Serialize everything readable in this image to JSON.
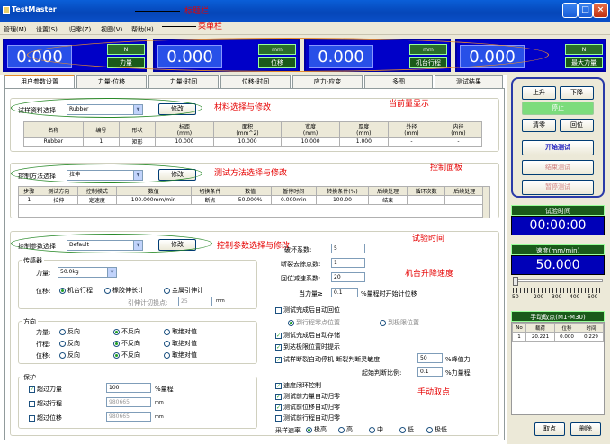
{
  "window": {
    "title": "TestMaster",
    "minimize": "_",
    "maximize": "□",
    "close": "×"
  },
  "menu": [
    "管理(M)",
    "设置(S)",
    "归零(Z)",
    "视图(V)",
    "帮助(H)"
  ],
  "readouts": [
    {
      "value": "0.000",
      "unit": "N",
      "label": "力量"
    },
    {
      "value": "0.000",
      "unit": "mm",
      "label": "位移"
    },
    {
      "value": "0.000",
      "unit": "mm",
      "label": "机台行程"
    },
    {
      "value": "0.000",
      "unit": "N",
      "label": "最大力量"
    }
  ],
  "tabs": [
    "用户参数设置",
    "力量-位移",
    "力量-时间",
    "位移-时间",
    "应力-应变",
    "多图",
    "测试结果"
  ],
  "material": {
    "label": "试样资料选择",
    "selected": "Rubber",
    "edit": "修改",
    "headers": [
      "名称",
      "编号",
      "形状",
      "标距",
      "面积",
      "宽度",
      "厚度",
      "外径",
      "内径"
    ],
    "units": [
      "",
      "",
      "",
      "(mm)",
      "(mm^2)",
      "(mm)",
      "(mm)",
      "(mm)",
      "(mm)"
    ],
    "row": [
      "Rubber",
      "1",
      "矩形",
      "10.000",
      "10.000",
      "10.000",
      "1.000",
      "-",
      "-"
    ]
  },
  "method": {
    "label": "控制方法选择",
    "selected": "拉伸",
    "edit": "修改",
    "headers": [
      "步骤",
      "测试方向",
      "控制模式",
      "数值",
      "切换条件",
      "数值",
      "暂停时间",
      "转换条件(%)",
      "后续处理",
      "循环次数",
      "后续处理"
    ],
    "row": [
      "1",
      "拉伸",
      "定速度",
      "100.000mm/min",
      "断点",
      "50.000%",
      "0.000min",
      "100.00",
      "结束",
      "",
      ""
    ]
  },
  "params": {
    "label": "控制参数选择",
    "selected": "Default",
    "edit": "修改",
    "sensor": "传感器",
    "force_label": "力量:",
    "force_value": "50.0kg",
    "disp_label": "位移:",
    "disp_opts": [
      "机台行程",
      "橡胶伸长计",
      "金属引伸计"
    ],
    "switch_label": "引伸计切换点:",
    "switch_value": "25",
    "switch_unit": "mm",
    "direction": "方向",
    "dir_rows": [
      {
        "label": "力量:",
        "opts": [
          "反向",
          "不反向",
          "取绝对值"
        ]
      },
      {
        "label": "行程:",
        "opts": [
          "反向",
          "不反向",
          "取绝对值"
        ]
      },
      {
        "label": "位移:",
        "opts": [
          "反向",
          "不反向",
          "取绝对值"
        ]
      }
    ],
    "protect": "保护",
    "prot_rows": [
      {
        "label": "超过力量",
        "value": "100",
        "unit": "%量程"
      },
      {
        "label": "超过行程",
        "value": "980665",
        "unit": "mm"
      },
      {
        "label": "超过位移",
        "value": "980665",
        "unit": "mm"
      }
    ],
    "break_coef_label": "破坏系数:",
    "break_coef": "5",
    "remove_label": "断裂去除点数:",
    "remove": "1",
    "return_label": "回位减速系数:",
    "return": "20",
    "force_ge_label": "当力量≥",
    "force_ge": "0.1",
    "force_ge_unit": "%量程时开始计位移",
    "chk1": "测试完成后自动回位",
    "sub1": "到行程零点位置",
    "sub2": "到极限位置",
    "chk2": "测试完成后自动存储",
    "chk3": "到达极限位置时提示",
    "chk4": "试样断裂自动停机 断裂判断灵敏度:",
    "sens": "50",
    "sens_unit": "%峰值力",
    "start_label": "起始判断比例:",
    "start": "0.1",
    "start_unit": "%力量程",
    "chk5": "速度闭环控制",
    "chk6": "测试前力量自动归零",
    "chk7": "测试前位移自动归零",
    "chk8": "测试前行程自动归零",
    "rate_label": "采样速率",
    "rate_opts": [
      "极高",
      "高",
      "中",
      "低",
      "极低"
    ]
  },
  "control": {
    "up": "上升",
    "down": "下降",
    "stop": "停止",
    "clear": "清零",
    "return": "回位",
    "start": "开始测试",
    "end": "结束测试",
    "pause": "暂停测试"
  },
  "time": {
    "label": "试验时间",
    "value": "00:00:00"
  },
  "speed": {
    "label": "速度(mm/min)",
    "value": "50.000",
    "scale": [
      "50",
      "200",
      "300",
      "400",
      "500"
    ]
  },
  "manual": {
    "label": "手动取点(M1-M30)",
    "headers": [
      "No",
      "载荷",
      "位移",
      "时间"
    ],
    "row": [
      "1",
      "20.221",
      "0.000",
      "0.229"
    ],
    "pick": "取点",
    "delete": "删除"
  },
  "annotations": {
    "title": "标题栏",
    "menu": "菜单栏",
    "display": "当前量显示",
    "material": "材料选择与修改",
    "method": "测试方法选择与修改",
    "panel": "控制面板",
    "params": "控制参数选择与修改",
    "time": "试验时间",
    "speed": "机台升降速度",
    "manual": "手动取点"
  }
}
